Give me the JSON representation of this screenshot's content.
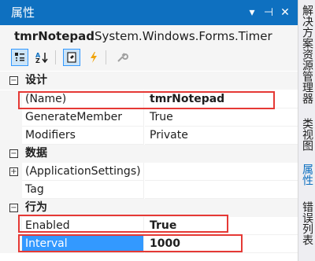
{
  "panel": {
    "title": "属性",
    "title_buttons": [
      "▾",
      "⊣",
      "✕"
    ]
  },
  "object": {
    "name": "tmrNotepad",
    "type": "System.Windows.Forms.Timer"
  },
  "toolbar": {
    "categorized_icon": "categorized-icon",
    "alphabetical_icon": "alphabetical-icon",
    "properties_icon": "properties-page-icon",
    "events_icon": "events-lightning-icon",
    "property_pages_icon": "wrench-icon"
  },
  "grid": {
    "categories": [
      {
        "label": "设计",
        "toggle": "⊟",
        "properties": [
          {
            "name": "(Name)",
            "value": "tmrNotepad",
            "bold": true
          },
          {
            "name": "GenerateMember",
            "value": "True",
            "bold": false
          },
          {
            "name": "Modifiers",
            "value": "Private",
            "bold": false
          }
        ]
      },
      {
        "label": "数据",
        "toggle": "⊟",
        "properties": [
          {
            "name": "(ApplicationSettings)",
            "value": "",
            "bold": false,
            "expander": "+"
          },
          {
            "name": "Tag",
            "value": "",
            "bold": false
          }
        ]
      },
      {
        "label": "行为",
        "toggle": "⊟",
        "properties": [
          {
            "name": "Enabled",
            "value": "True",
            "bold": true
          },
          {
            "name": "Interval",
            "value": "1000",
            "bold": true,
            "selected": true
          }
        ]
      }
    ]
  },
  "sidebar": {
    "tabs": [
      "解决方案资源管理器",
      "类视图",
      "属性",
      "错误列表"
    ],
    "active_tab": "属性"
  },
  "highlight_color": "#e53935",
  "accent_color": "#0e70c0"
}
